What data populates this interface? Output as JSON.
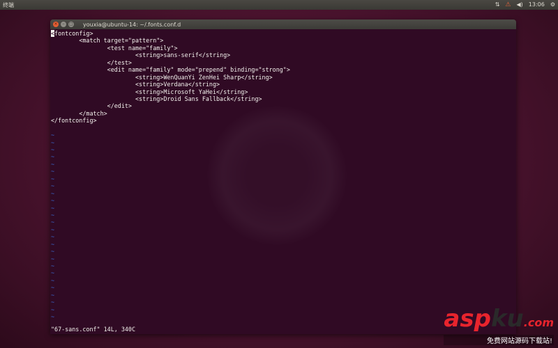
{
  "panel": {
    "title": "终端",
    "tray": {
      "network": "⇅",
      "alert": "⚠",
      "volume": "◀)",
      "clock": "13:06",
      "settings": "⚙"
    }
  },
  "window": {
    "title": "youxia@ubuntu-14: ~/.fonts.conf.d",
    "buttons": {
      "close": "×",
      "minimize": "–",
      "maximize": "□"
    }
  },
  "editor": {
    "cursor_char": "<",
    "first_line_rest": "fontconfig>",
    "lines": [
      "        <match target=\"pattern\">",
      "                <test name=\"family\">",
      "                        <string>sans-serif</string>",
      "                </test>",
      "                <edit name=\"family\" mode=\"prepend\" binding=\"strong\">",
      "                        <string>WenQuanYi ZenHei Sharp</string>",
      "                        <string>Verdana</string>",
      "                        <string>Microsoft YaHei</string>",
      "                        <string>Droid Sans Fallback</string>",
      "                </edit>",
      "        </match>",
      "</fontconfig>",
      ""
    ],
    "tilde_char": "~",
    "tilde_count": 26,
    "status_line": "\"67-sans.conf\" 14L, 340C"
  },
  "watermark": {
    "brand_red": "asp",
    "brand_dark": "ku",
    "brand_tld": ".com",
    "tagline": "免费网站源码下载站!"
  }
}
